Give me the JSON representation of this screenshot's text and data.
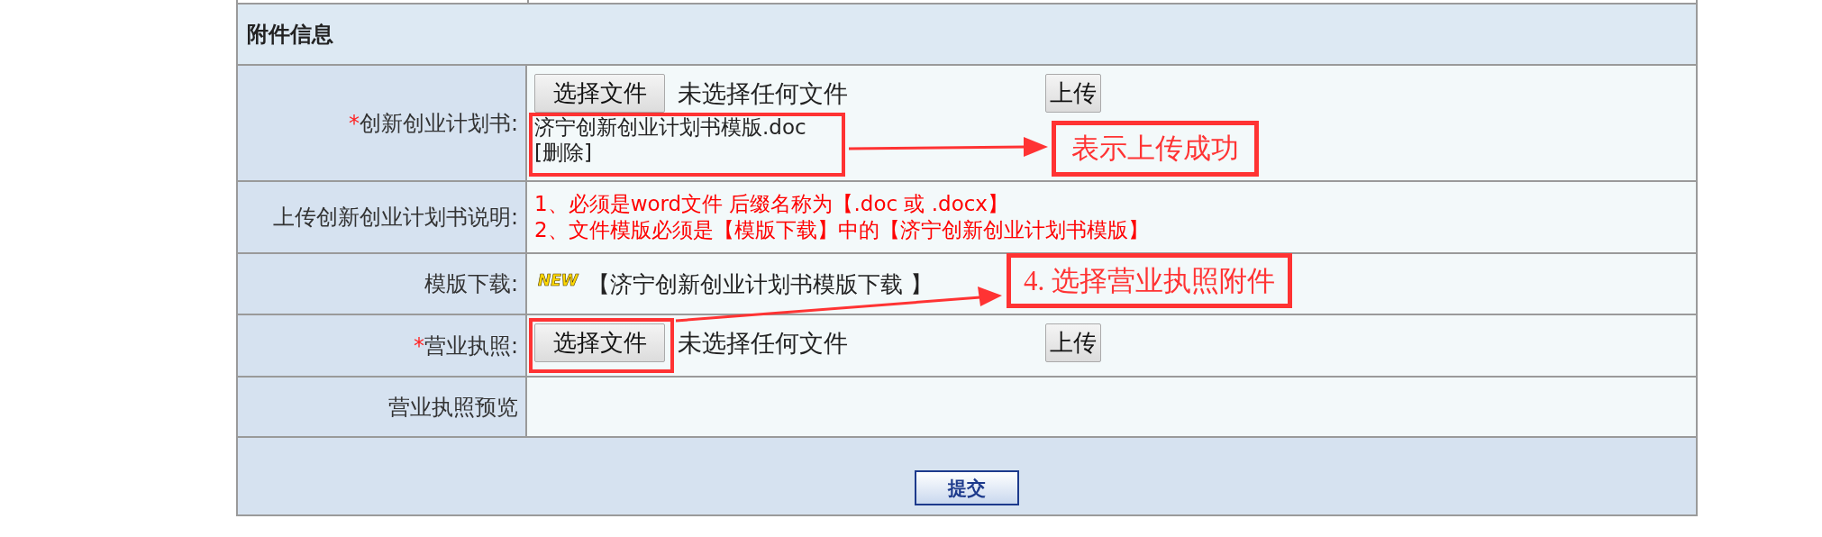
{
  "section": {
    "title": "附件信息"
  },
  "rows": [
    {
      "kind": "file",
      "mark": "*",
      "label": "创新创业计划书:",
      "choose_button": "选择文件",
      "file_status": "未选择任何文件",
      "upload_button": "上传",
      "uploaded": {
        "name": "济宁创新创业计划书模版.doc",
        "delete": "[删除]"
      }
    },
    {
      "kind": "notes",
      "label": "上传创新创业计划书说明:",
      "lines": [
        "1、必须是word文件 后缀名称为【.doc 或 .docx】",
        "2、文件模版必须是【模版下载】中的【济宁创新创业计划书模版】"
      ]
    },
    {
      "kind": "download",
      "label": "模版下载:",
      "badge": "NEW",
      "link": "【济宁创新创业计划书模版下载 】"
    },
    {
      "kind": "file",
      "mark": "*",
      "label": "营业执照:",
      "choose_button": "选择文件",
      "file_status": "未选择任何文件",
      "upload_button": "上传"
    },
    {
      "kind": "preview",
      "label": "营业执照预览"
    }
  ],
  "submit_button": "提交",
  "annotations": [
    {
      "kind": "callout",
      "text": "表示上传成功"
    },
    {
      "kind": "callout",
      "text": "4. 选择营业执照附件"
    }
  ]
}
